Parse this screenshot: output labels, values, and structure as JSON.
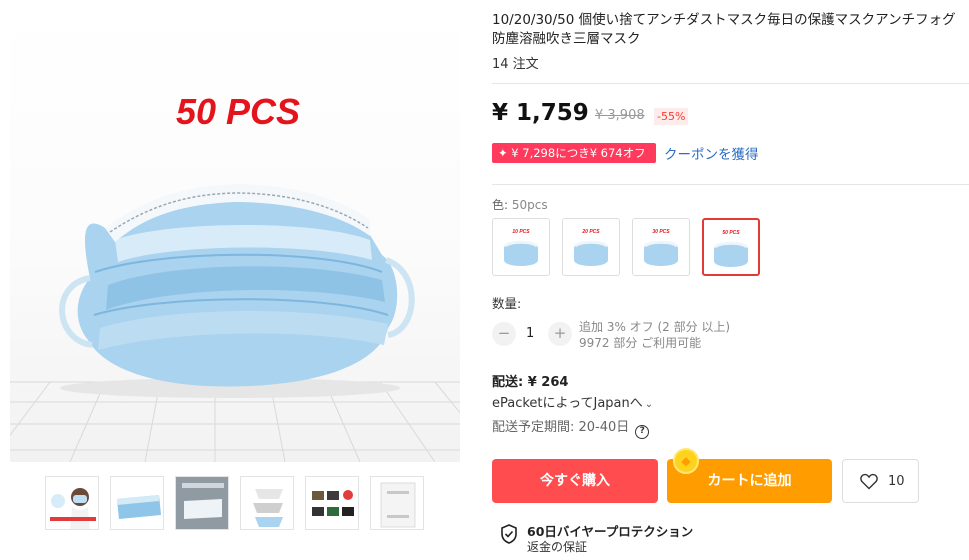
{
  "product": {
    "badge_text": "50 PCS",
    "title": "10/20/30/50 個使い捨てアンチダストマスク毎日の保護マスクアンチフォグ防塵溶融吹き三層マスク",
    "orders": "14 注文"
  },
  "price": {
    "current": "¥ 1,759",
    "original": "¥ 3,908",
    "discount": "-55%"
  },
  "coupon": {
    "badge": "¥ 7,298につき¥ 674オフ",
    "link": "クーポンを獲得"
  },
  "color": {
    "label": "色:",
    "selected": "50pcs",
    "options": [
      {
        "label": "10 PCS",
        "selected": false
      },
      {
        "label": "20 PCS",
        "selected": false
      },
      {
        "label": "30 PCS",
        "selected": false
      },
      {
        "label": "50 PCS",
        "selected": true
      }
    ]
  },
  "quantity": {
    "label": "数量:",
    "value": "1",
    "minus": "−",
    "plus": "+",
    "discount_note": "追加 3% オフ (2 部分 以上)",
    "available": "9972 部分 ご利用可能"
  },
  "shipping": {
    "price": "配送: ¥ 264",
    "method": "ePacketによってJapanへ",
    "method_chevron": "⌄",
    "time": "配送予定期間: 20-40日",
    "help": "?"
  },
  "actions": {
    "buy_now": "今すぐ購入",
    "add_to_cart": "カートに追加",
    "wishlist_count": "10"
  },
  "protection": {
    "title": "60日バイヤープロテクション",
    "subtitle": "返金の保証"
  },
  "colors": {
    "buy_button": "#ff4d4f",
    "cart_button": "#ff9d00",
    "coupon_badge": "#ff3a5c",
    "link": "#2b6cc4",
    "selected_border": "#e53935",
    "mask_blue": "#a9d3ee"
  }
}
